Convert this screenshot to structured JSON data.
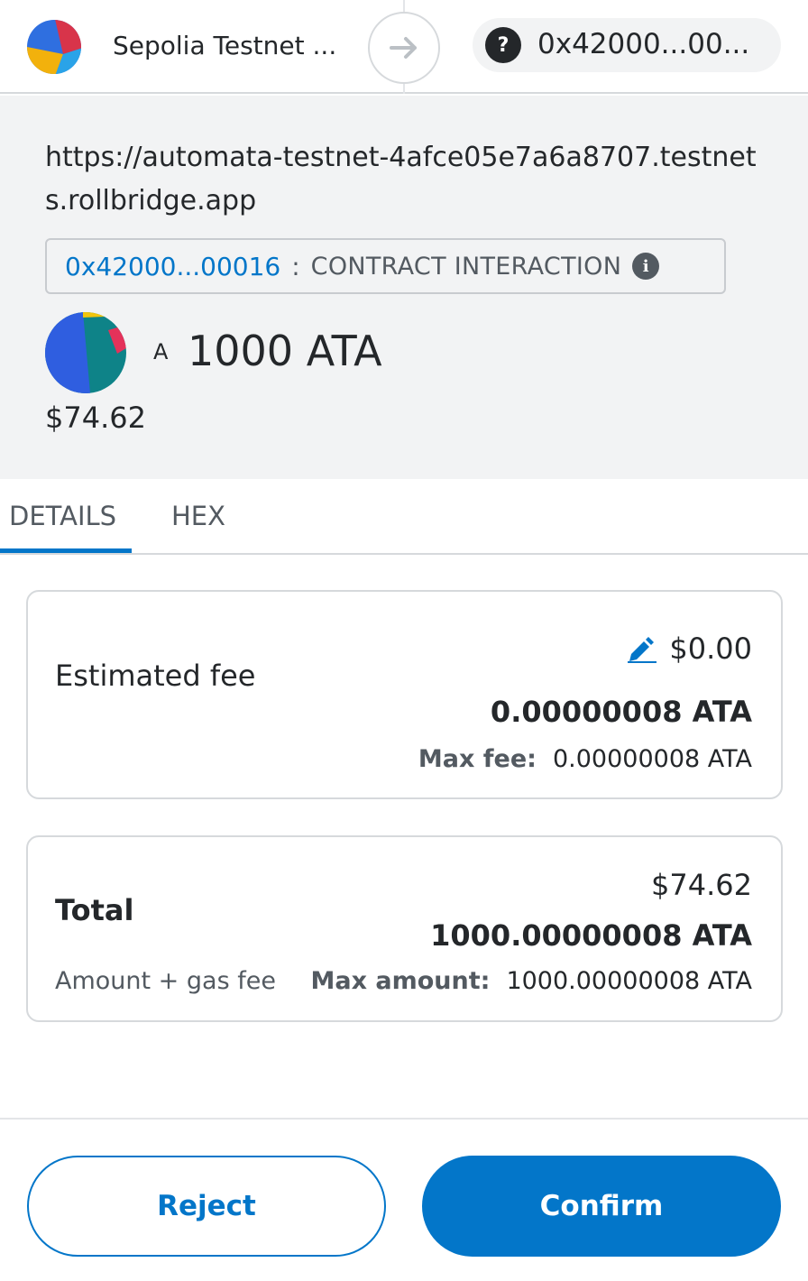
{
  "header": {
    "network_name": "Sepolia Testnet ...",
    "account_address": "0x42000...00...",
    "account_icon_glyph": "?"
  },
  "summary": {
    "origin": "https://automata-testnet-4afce05e7a6a8707.testnets.rollbridge.app",
    "contract_address": "0x42000...00016",
    "contract_separator": ":",
    "contract_label": "CONTRACT INTERACTION",
    "info_glyph": "i",
    "token_letter": "A",
    "amount": "1000 ATA",
    "fiat": "$74.62"
  },
  "tabs": [
    {
      "label": "DETAILS",
      "active": true
    },
    {
      "label": "HEX",
      "active": false
    }
  ],
  "fee": {
    "label": "Estimated fee",
    "fiat": "$0.00",
    "native": "0.00000008 ATA",
    "max_label": "Max fee:",
    "max_value": "0.00000008 ATA"
  },
  "total": {
    "label": "Total",
    "sub_label": "Amount + gas fee",
    "fiat": "$74.62",
    "native": "1000.00000008 ATA",
    "max_label": "Max amount:",
    "max_value": "1000.00000008 ATA"
  },
  "footer": {
    "reject_label": "Reject",
    "confirm_label": "Confirm"
  },
  "colors": {
    "primary": "#0376c9",
    "background_grey": "#f2f3f4",
    "text": "#24272a",
    "muted_text": "#535a61",
    "border": "#d6d9dc"
  },
  "icons": {
    "network": "network-logo-icon",
    "arrow": "arrow-right-icon",
    "account": "question-mark-icon",
    "info": "info-icon",
    "token": "token-identicon",
    "edit": "edit-pencil-icon"
  }
}
